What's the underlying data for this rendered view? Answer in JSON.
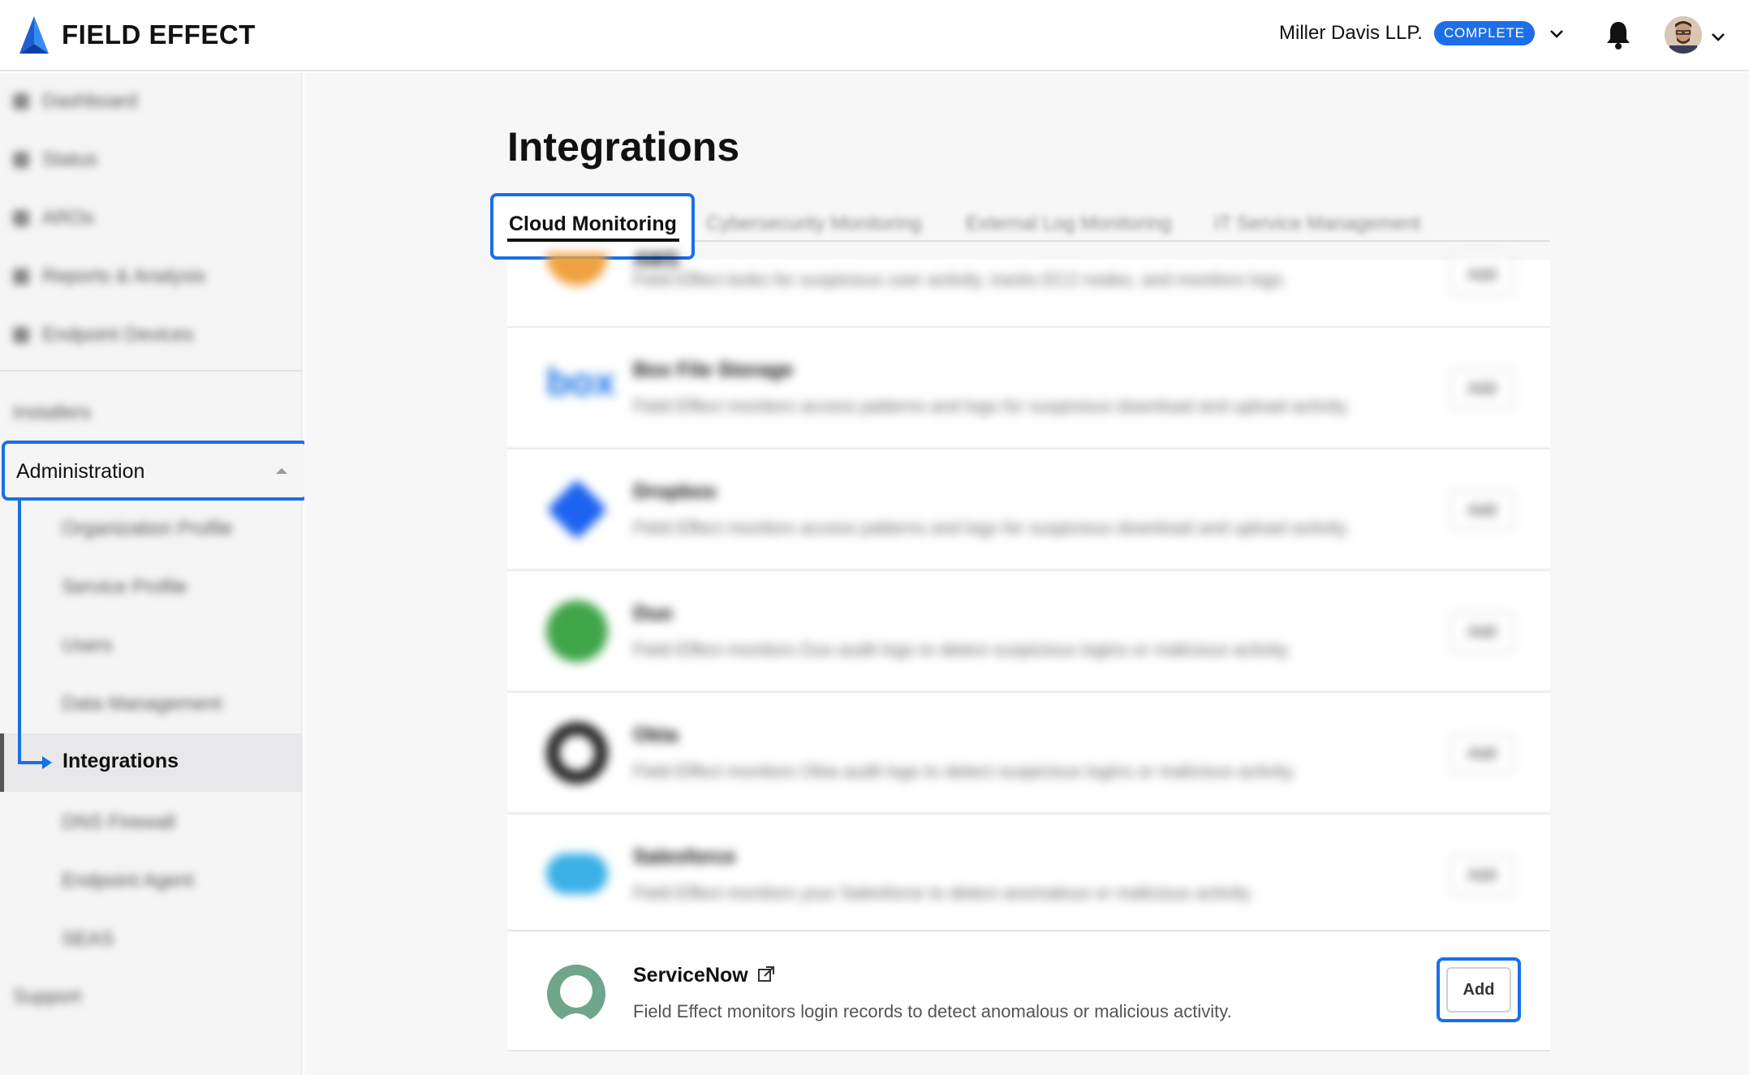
{
  "header": {
    "logo_text": "FIELD EFFECT",
    "org_name": "Miller Davis LLP.",
    "badge": "COMPLETE",
    "accent_color": "#1c6fe8"
  },
  "sidebar": {
    "items": [
      {
        "label": "Dashboard",
        "icon": "dashboard-icon"
      },
      {
        "label": "Status",
        "icon": "status-icon"
      },
      {
        "label": "AROs",
        "icon": "aro-icon"
      },
      {
        "label": "Reports & Analysis",
        "icon": "reports-icon"
      },
      {
        "label": "Endpoint Devices",
        "icon": "devices-icon"
      }
    ],
    "installers": "Installers",
    "administration": "Administration",
    "sub_items": [
      "Organization Profile",
      "Service Profile",
      "Users",
      "Data Management"
    ],
    "active_sub": "Integrations",
    "after_items": [
      "DNS Firewall",
      "Endpoint Agent",
      "SEAS"
    ],
    "support": "Support"
  },
  "main": {
    "title": "Integrations",
    "tabs": [
      {
        "label": "Cloud Monitoring",
        "active": true
      },
      {
        "label": "Cybersecurity Monitoring",
        "active": false
      },
      {
        "label": "External Log Monitoring",
        "active": false
      },
      {
        "label": "IT Service Management",
        "active": false
      }
    ],
    "integrations": [
      {
        "name": "AWS",
        "desc": "Field Effect looks for suspicious user activity, tracks EC2 nodes, and monitors logs.",
        "add": "Add"
      },
      {
        "name": "Box File Storage",
        "desc": "Field Effect monitors access patterns and logs for suspicious download and upload activity.",
        "add": "Add"
      },
      {
        "name": "Dropbox",
        "desc": "Field Effect monitors access patterns and logs for suspicious download and upload activity.",
        "add": "Add"
      },
      {
        "name": "Duo",
        "desc": "Field Effect monitors Duo audit logs to detect suspicious logins or malicious activity.",
        "add": "Add"
      },
      {
        "name": "Okta",
        "desc": "Field Effect monitors Okta audit logs to detect suspicious logins or malicious activity.",
        "add": "Add"
      },
      {
        "name": "Salesforce",
        "desc": "Field Effect monitors your Salesforce to detect anomalous or malicious activity.",
        "add": "Add"
      }
    ],
    "servicenow": {
      "name": "ServiceNow",
      "desc": "Field Effect monitors login records to detect anomalous or malicious activity.",
      "add": "Add"
    }
  }
}
